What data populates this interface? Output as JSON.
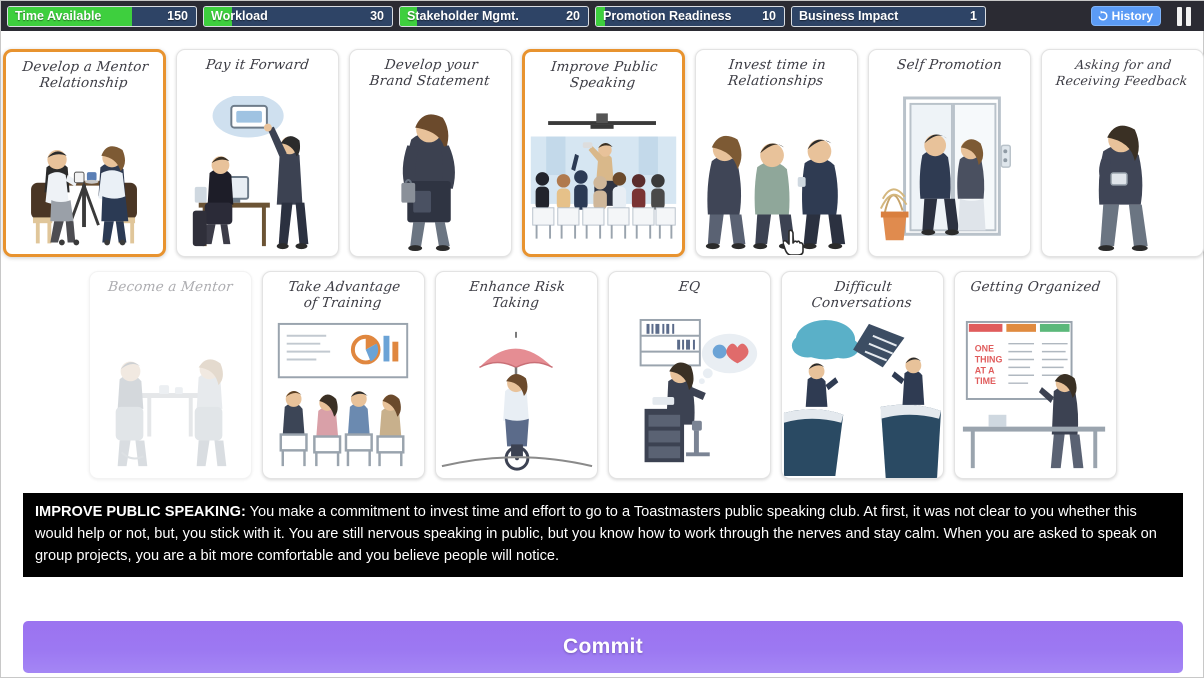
{
  "topbar": {
    "meters": [
      {
        "label": "Time Available",
        "value": "150",
        "fill_pct": 66
      },
      {
        "label": "Workload",
        "value": "30",
        "fill_pct": 15
      },
      {
        "label": "Stakeholder Mgmt.",
        "value": "20",
        "fill_pct": 9
      },
      {
        "label": "Promotion Readiness",
        "value": "10",
        "fill_pct": 5
      },
      {
        "label": "Business Impact",
        "value": "1",
        "fill_pct": 0
      }
    ],
    "history_label": "History",
    "pause_label": "Pause"
  },
  "cards": {
    "row1": [
      {
        "title_line1": "Develop a Mentor",
        "title_line2": "Relationship",
        "selected": true,
        "disabled": false,
        "art": "mentor-meeting"
      },
      {
        "title_line1": "Pay it Forward",
        "title_line2": "",
        "selected": false,
        "disabled": false,
        "art": "desk-presentation"
      },
      {
        "title_line1": "Develop your",
        "title_line2": "Brand Statement",
        "selected": false,
        "disabled": false,
        "art": "woman-with-bag"
      },
      {
        "title_line1": "Improve Public",
        "title_line2": "Speaking",
        "selected": true,
        "disabled": false,
        "art": "audience-speaker"
      },
      {
        "title_line1": "Invest time in",
        "title_line2": "Relationships",
        "selected": false,
        "disabled": false,
        "art": "three-people"
      },
      {
        "title_line1": "Self Promotion",
        "title_line2": "",
        "selected": false,
        "disabled": false,
        "art": "elevator-pair"
      },
      {
        "title_line1": "Asking for and",
        "title_line2": "Receiving Feedback",
        "selected": false,
        "disabled": false,
        "art": "single-person"
      }
    ],
    "row2": [
      {
        "title_line1": "Become a Mentor",
        "title_line2": "",
        "selected": false,
        "disabled": true,
        "art": "mentor-table"
      },
      {
        "title_line1": "Take Advantage",
        "title_line2": "of Training",
        "selected": false,
        "disabled": false,
        "art": "classroom"
      },
      {
        "title_line1": "Enhance Risk",
        "title_line2": "Taking",
        "selected": false,
        "disabled": false,
        "art": "umbrella-tightrope"
      },
      {
        "title_line1": "EQ",
        "title_line2": "",
        "selected": false,
        "disabled": false,
        "art": "desk-thought"
      },
      {
        "title_line1": "Difficult",
        "title_line2": "Conversations",
        "selected": false,
        "disabled": false,
        "art": "cliff-gap"
      },
      {
        "title_line1": "Getting Organized",
        "title_line2": "",
        "selected": false,
        "disabled": false,
        "art": "whiteboard-list"
      }
    ]
  },
  "description": {
    "heading": "IMPROVE PUBLIC SPEAKING:",
    "body": " You make a commitment to invest time and effort to go to a Toastmasters public speaking club. At first, it was not clear to you whether this would help or not, but, you stick with it. You are still nervous speaking in public, but you know how to work through the nerves and stay calm. When you are asked to speak on group projects, you are a bit more comfortable and you believe people will notice."
  },
  "commit": {
    "label": "Commit"
  },
  "colors": {
    "selected_border": "#e8932f",
    "meter_fill": "#3ecf3e",
    "meter_bg": "#2e4466",
    "topbar_bg": "#2b2b33",
    "commit_bg": "#9c78f2",
    "history_bg": "#5b9bf5"
  }
}
